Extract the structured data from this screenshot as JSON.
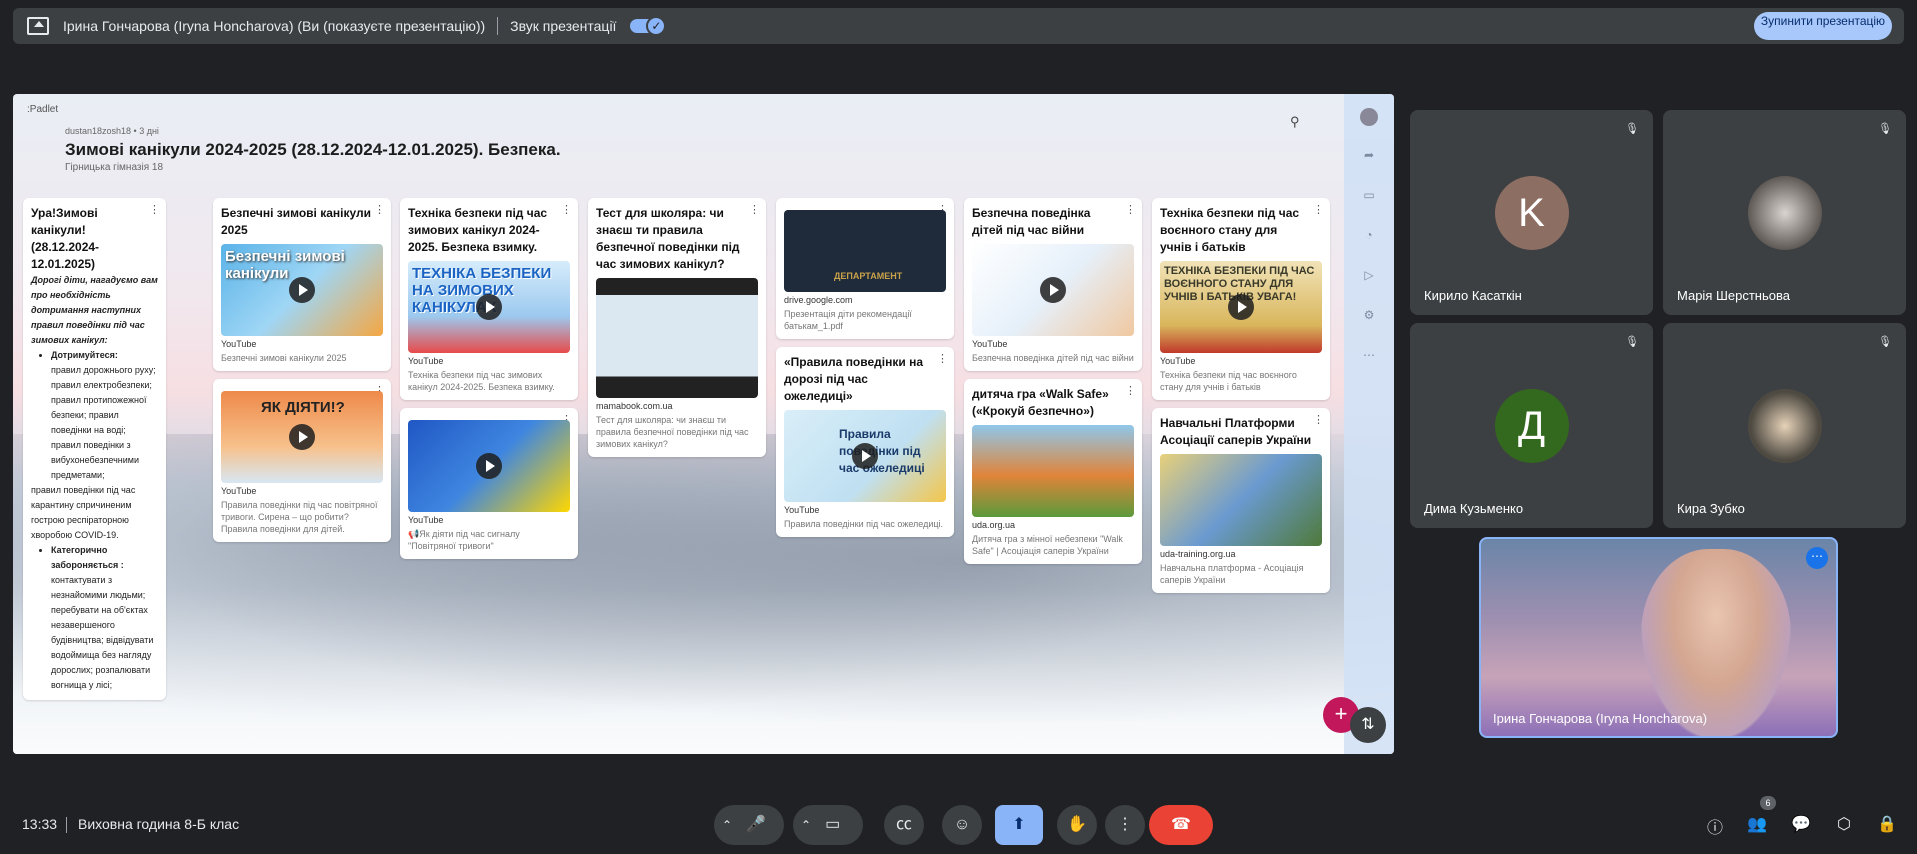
{
  "topbar": {
    "presenter_text": "Ірина Гончарова (Iryna Honcharova) (Ви (показуєте презентацію))",
    "sound_label": "Звук презентації",
    "stop_button": "Зупинити презентацію"
  },
  "padlet": {
    "logo": ":Padlet",
    "meta": "dustan18zosh18 • 3 дні",
    "title": "Зимові канікули 2024-2025 (28.12.2024-12.01.2025). Безпека.",
    "subtitle": "Гірницька гімназія 18",
    "columns": [
      {
        "cards": [
          {
            "title": "Ура!Зимові канікули! (28.12.2024-12.01.2025)",
            "intro": "Дорогі діти, нагадуємо вам про необхідність дотримання наступних правил поведінки під час зимових канікул:",
            "list1_head": "Дотримуйтеся:",
            "list1_body": "правил дорожнього руху; правил електробезпеки; правил протипожежної безпеки; правил поведінки на воді; правил поведінки з вибухонебезпечними предметами;",
            "middle": "правил поведінки під час карантину спричиненим гострою респіраторною хворобою COVID-19.",
            "list2_head": "Категорично забороняється :",
            "list2_body": "контактувати з незнайомими людьми; перебувати на об'єктах незавершеного будівництва; відвідувати водоймища без нагляду дорослих; розпалювати вогнища у лісі;"
          }
        ]
      },
      {
        "cards": [
          {
            "title": "Безпечні зимові канікули 2025",
            "thumb_text": "Безпечні зимові канікули",
            "source": "YouTube",
            "caption": "Безпечні зимові канікули 2025"
          },
          {
            "title": "",
            "thumb_text": "ЯК ДІЯТИ!?",
            "source": "YouTube",
            "caption": "Правила поведінки під час повітряної тривоги. Сирена – що робити? Правила поведінки для дітей."
          }
        ]
      },
      {
        "cards": [
          {
            "title": "Техніка безпеки під час зимових канікул 2024-2025. Безпека взимку.",
            "thumb_text": "ТЕХНІКА БЕЗПЕКИ НА ЗИМОВИХ КАНІКУЛАХ",
            "source": "YouTube",
            "caption": "Техніка безпеки під час зимових канікул 2024-2025. Безпека взимку."
          },
          {
            "title": "",
            "thumb_text": "",
            "source": "YouTube",
            "caption": "📢Як діяти під час сигналу \"Повітряної тривоги\""
          }
        ]
      },
      {
        "cards": [
          {
            "title": "Тест для школяра: чи знаєш ти правила безпечної поведінки під час зимових канікул?",
            "thumb_text": "",
            "source": "mamabook.com.ua",
            "caption": "Тест для школяра: чи знаєш ти правила безпечної поведінки під час зимових канікул?"
          }
        ]
      },
      {
        "cards": [
          {
            "title": "",
            "thumb_text": "ДЕПАРТАМЕНТ",
            "source": "drive.google.com",
            "caption": "Презентація діти рекомендації батькам_1.pdf"
          },
          {
            "title": "«Правила поведінки на дорозі під час ожеледиці»",
            "thumb_text": "Правила поведінки під час ожеледиці",
            "source": "YouTube",
            "caption": "Правила поведінки під час ожеледиці."
          }
        ]
      },
      {
        "cards": [
          {
            "title": "Безпечна поведінка дітей під час війни",
            "thumb_text": "",
            "source": "YouTube",
            "caption": "Безпечна поведінка дітей під час війни"
          },
          {
            "title": "дитяча гра «Walk Safe» («Крокуй безпечно»)",
            "thumb_text": "",
            "source": "uda.org.ua",
            "caption": "Дитяча гра з мінної небезпеки \"Walk Safe\" | Асоціація саперів України"
          }
        ]
      },
      {
        "cards": [
          {
            "title": "Техніка безпеки під час воєнного стану для учнів і батьків",
            "thumb_text": "ТЕХНІКА БЕЗПЕКИ ПІД ЧАС ВОЄННОГО СТАНУ ДЛЯ УЧНІВ І БАТЬКІВ УВАГА!",
            "source": "YouTube",
            "caption": "Техніка безпеки під час воєнного стану для учнів і батьків"
          },
          {
            "title": "Навчальні Платформи Асоціації саперів України",
            "thumb_text": "",
            "source": "uda-training.org.ua",
            "caption": "Навчальна платформа - Асоціація саперів України"
          }
        ]
      }
    ]
  },
  "participants": [
    {
      "name": "Кирило Касаткін",
      "initial": "K",
      "color": "#8d6e63"
    },
    {
      "name": "Марія Шерстньова",
      "initial": "",
      "color": "#5f6368"
    },
    {
      "name": "Дима Кузьменко",
      "initial": "Д",
      "color": "#33691e"
    },
    {
      "name": "Кира Зубко",
      "initial": "",
      "color": "#4e4a42"
    }
  ],
  "self": {
    "name": "Ірина Гончарова (Iryna Honcharova)"
  },
  "bottombar": {
    "time": "13:33",
    "meeting_name": "Виховна година 8-Б клас",
    "participants_count": "6"
  },
  "icons": {
    "mic": "mic-icon",
    "camera": "camera-icon",
    "captions": "captions-icon",
    "emoji": "emoji-icon",
    "present": "present-icon",
    "hand": "raise-hand-icon",
    "more": "more-options-icon",
    "hangup": "hangup-icon"
  }
}
